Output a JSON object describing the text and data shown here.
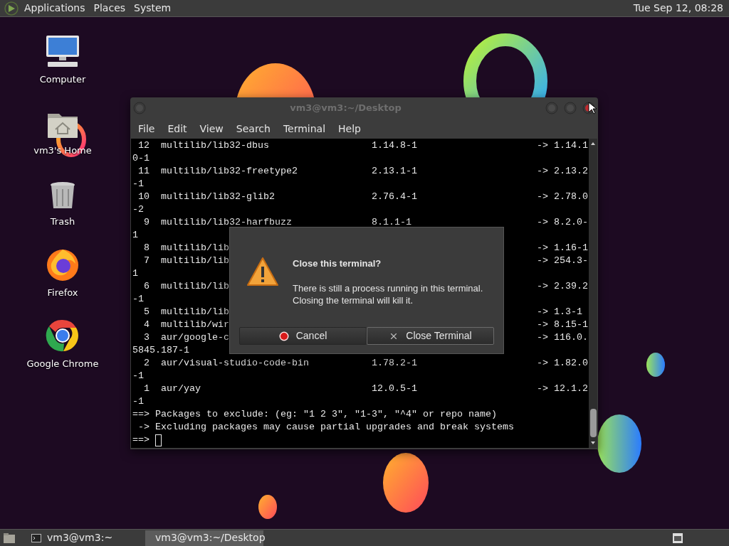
{
  "top_panel": {
    "menus": [
      "Applications",
      "Places",
      "System"
    ],
    "clock": "Tue Sep 12, 08:28"
  },
  "desktop_icons": [
    {
      "label": "Computer",
      "kind": "computer"
    },
    {
      "label": "vm3's Home",
      "kind": "home"
    },
    {
      "label": "Trash",
      "kind": "trash"
    },
    {
      "label": "Firefox",
      "kind": "firefox"
    },
    {
      "label": "Google Chrome",
      "kind": "chrome"
    }
  ],
  "terminal": {
    "title": "vm3@vm3:~/Desktop",
    "menu": [
      "File",
      "Edit",
      "View",
      "Search",
      "Terminal",
      "Help"
    ],
    "rows": [
      {
        "num": "12",
        "name": "multilib/lib32-dbus",
        "version": "1.14.8-1",
        "new": "-> 1.14.1",
        "wrap": "0-1"
      },
      {
        "num": "11",
        "name": "multilib/lib32-freetype2",
        "version": "2.13.1-1",
        "new": "-> 2.13.2",
        "wrap": "-1"
      },
      {
        "num": "10",
        "name": "multilib/lib32-glib2",
        "version": "2.76.4-1",
        "new": "-> 2.78.0",
        "wrap": "-2"
      },
      {
        "num": "9",
        "name": "multilib/lib32-harfbuzz",
        "version": "8.1.1-1",
        "new": "-> 8.2.0-",
        "wrap": "1"
      },
      {
        "num": "8",
        "name": "multilib/lib",
        "new": "-> 1.16-1"
      },
      {
        "num": "7",
        "name": "multilib/lib",
        "new": "-> 254.3-",
        "wrap": "1"
      },
      {
        "num": "6",
        "name": "multilib/lib",
        "new": "-> 2.39.2",
        "wrap": "-1"
      },
      {
        "num": "5",
        "name": "multilib/lib",
        "new": "-> 1.3-1"
      },
      {
        "num": "4",
        "name": "multilib/wir",
        "new": "-> 8.15-1"
      },
      {
        "num": "3",
        "name": "aur/google-c",
        "new": "-> 116.0.",
        "wrap": "5845.187-1"
      },
      {
        "num": "2",
        "name": "aur/visual-studio-code-bin",
        "version": "1.78.2-1",
        "new": "-> 1.82.0",
        "wrap": "-1"
      },
      {
        "num": "1",
        "name": "aur/yay",
        "version": "12.0.5-1",
        "new": "-> 12.1.2",
        "wrap": "-1"
      }
    ],
    "lines": [
      "==> Packages to exclude: (eg: \"1 2 3\", \"1-3\", \"^4\" or repo name)",
      " -> Excluding packages may cause partial upgrades and break systems"
    ],
    "prompt": "==>"
  },
  "dialog": {
    "title": "Close this terminal?",
    "message": "There is still a process running in this terminal.\nClosing the terminal will kill it.",
    "buttons": [
      {
        "label": "Cancel",
        "kind": "cancel",
        "focused": false
      },
      {
        "label": "Close Terminal",
        "kind": "close",
        "focused": true
      }
    ]
  },
  "taskbar": {
    "tasks": [
      {
        "label": "vm3@vm3:~",
        "selected": false
      },
      {
        "label": "vm3@vm3:~/Desktop",
        "selected": true
      }
    ]
  }
}
